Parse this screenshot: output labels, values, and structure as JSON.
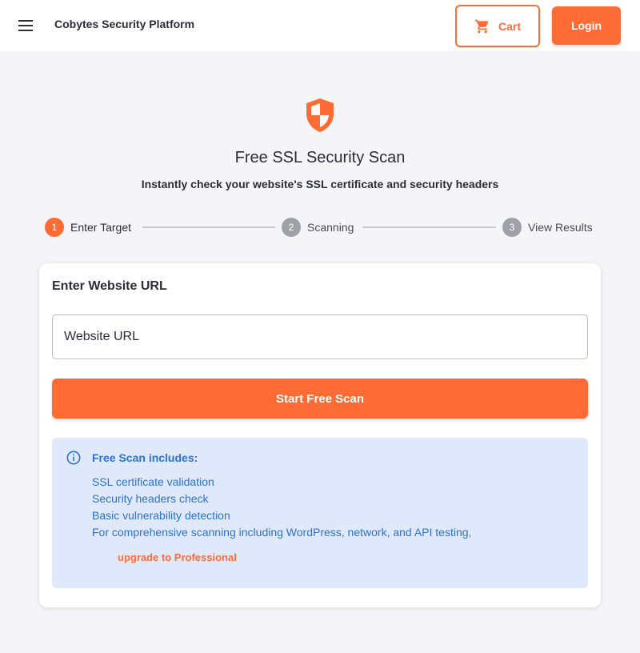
{
  "header": {
    "brand": "Cobytes Security Platform",
    "cart_label": "Cart",
    "login_label": "Login"
  },
  "hero": {
    "title": "Free SSL Security Scan",
    "subtitle": "Instantly check your website's SSL certificate and security headers"
  },
  "stepper": {
    "steps": [
      {
        "number": "1",
        "label": "Enter Target",
        "state": "active"
      },
      {
        "number": "2",
        "label": "Scanning",
        "state": "inactive"
      },
      {
        "number": "3",
        "label": "View Results",
        "state": "inactive"
      }
    ]
  },
  "form": {
    "card_title": "Enter Website URL",
    "url_placeholder": "Website URL",
    "url_value": "",
    "submit_label": "Start Free Scan"
  },
  "info": {
    "title": "Free Scan includes:",
    "items": [
      "SSL certificate validation",
      "Security headers check",
      "Basic vulnerability detection",
      "For comprehensive scanning including WordPress, network, and API testing,"
    ],
    "upgrade_link": "upgrade to Professional"
  },
  "icons": {
    "menu": "menu-icon",
    "cart": "cart-icon",
    "shield": "shield-icon",
    "info": "info-icon"
  },
  "colors": {
    "accent": "#ff6b35",
    "info_bg": "#dfe9fb",
    "info_text": "#2b72d6",
    "step_inactive": "#a0a0a8"
  }
}
